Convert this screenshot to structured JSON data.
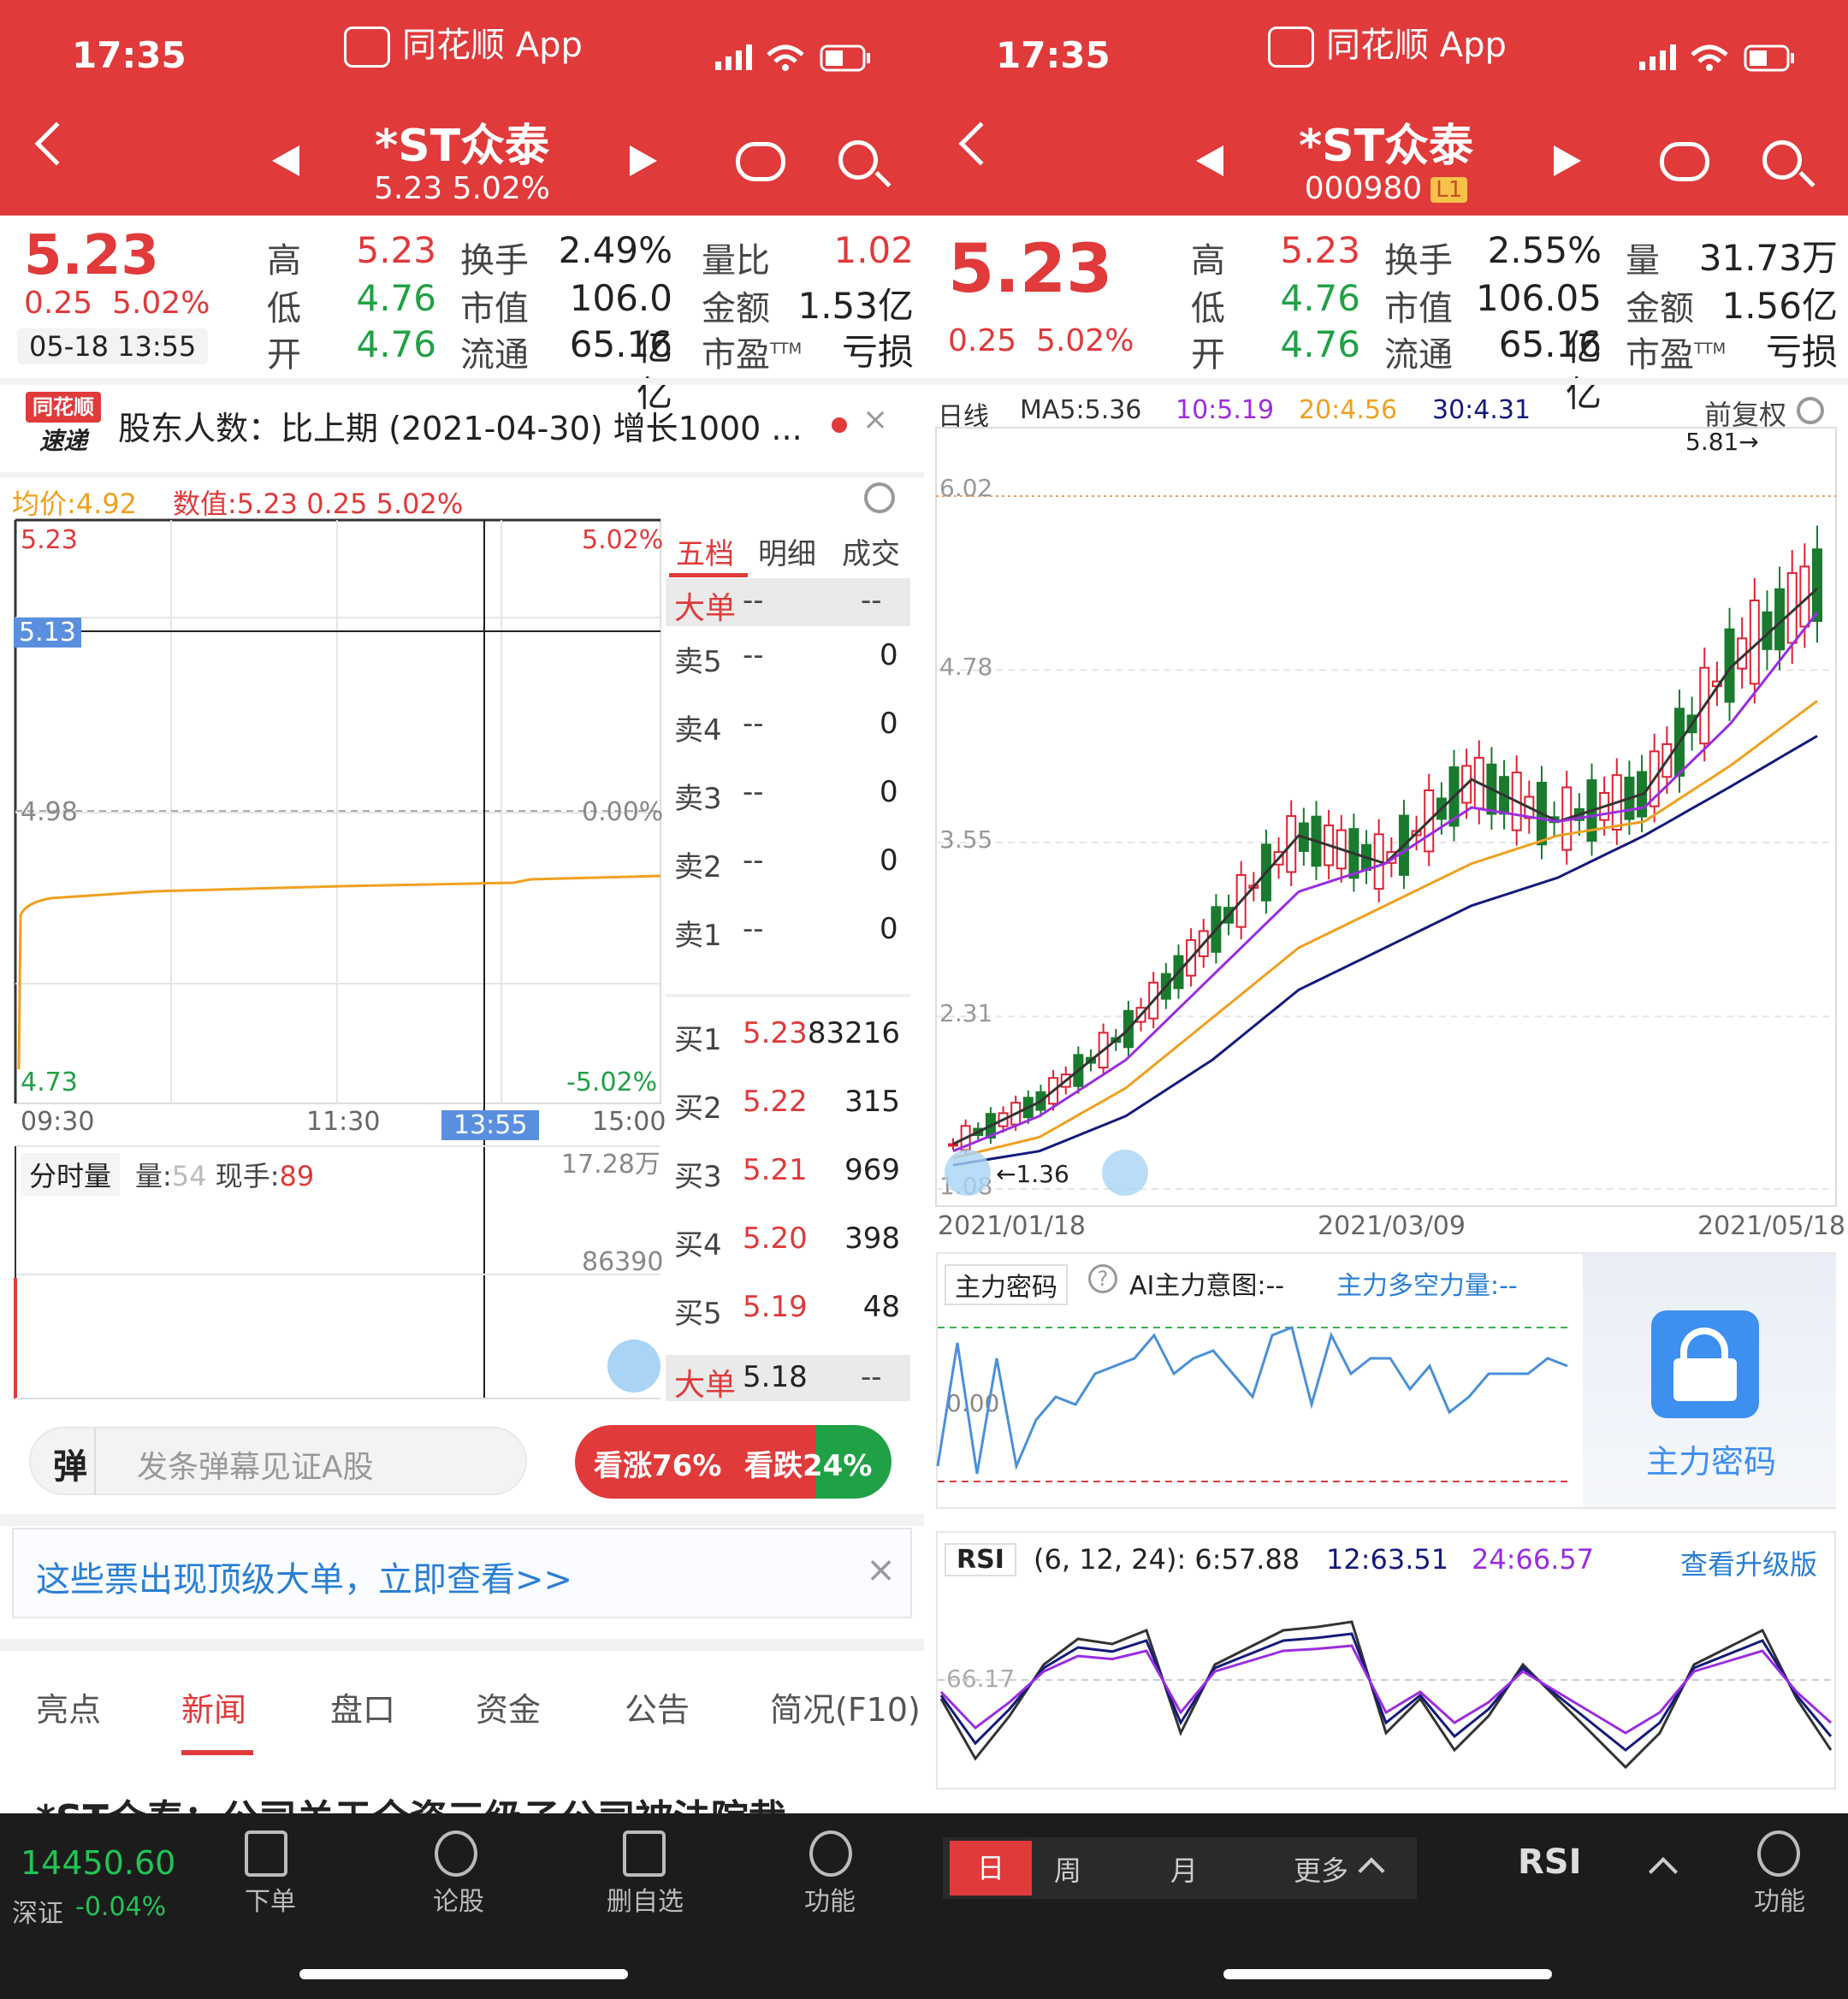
{
  "status_bar": {
    "time": "17:35",
    "app_name": "同花顺 App"
  },
  "left": {
    "header": {
      "title": "*ST众泰",
      "subtitle": "5.23 5.02%"
    },
    "quote": {
      "price": "5.23",
      "change": "0.25",
      "change_pct": "5.02%",
      "timestamp": "05-18 13:55",
      "high_label": "高",
      "high": "5.23",
      "low_label": "低",
      "low": "4.76",
      "open_label": "开",
      "open": "4.76",
      "turnover_label": "换手",
      "turnover": "2.49%",
      "mcap_label": "市值",
      "mcap": "106.0亿",
      "float_label": "流通",
      "float": "65.16亿",
      "vr_label": "量比",
      "vr": "1.02",
      "amount_label": "金额",
      "amount": "1.53亿",
      "pe_label": "市盈",
      "pe_sup": "TTM",
      "pe": "亏损"
    },
    "news_banner": {
      "logo_top": "同花顺",
      "logo_bottom": "速递",
      "text": "股东人数：比上期 (2021-04-30) 增长1000 ..."
    },
    "intraday": {
      "avg_label": "均价:4.92",
      "value_label": "数值:5.23 0.25 5.02%",
      "y_top": "5.23",
      "y_mid": "4.98",
      "y_bot": "4.73",
      "y_cursor": "5.13",
      "pct_top": "5.02%",
      "pct_mid": "0.00%",
      "pct_bot": "-5.02%",
      "x_labels": [
        "09:30",
        "11:30",
        "13:55",
        "15:00"
      ],
      "vol_title": "分时量",
      "vol_label": "量:",
      "vol_value": "54",
      "hand_label": "现手:",
      "hand_value": "89",
      "vol_top": "17.28万",
      "vol_mid": "86390"
    },
    "order_book": {
      "tabs": [
        "五档",
        "明细",
        "成交"
      ],
      "big_top": {
        "label": "大单",
        "price": "--",
        "qty": "--"
      },
      "sells": [
        {
          "label": "卖5",
          "price": "--",
          "qty": "0"
        },
        {
          "label": "卖4",
          "price": "--",
          "qty": "0"
        },
        {
          "label": "卖3",
          "price": "--",
          "qty": "0"
        },
        {
          "label": "卖2",
          "price": "--",
          "qty": "0"
        },
        {
          "label": "卖1",
          "price": "--",
          "qty": "0"
        }
      ],
      "buys": [
        {
          "label": "买1",
          "price": "5.23",
          "qty": "83216"
        },
        {
          "label": "买2",
          "price": "5.22",
          "qty": "315"
        },
        {
          "label": "买3",
          "price": "5.21",
          "qty": "969"
        },
        {
          "label": "买4",
          "price": "5.20",
          "qty": "398"
        },
        {
          "label": "买5",
          "price": "5.19",
          "qty": "48"
        }
      ],
      "big_bottom": {
        "label": "大单",
        "price": "5.18",
        "qty": "--"
      }
    },
    "danmu": {
      "icon": "弹",
      "placeholder": "发条弹幕见证A股"
    },
    "sentiment": {
      "up": "看涨76%",
      "down": "看跌24%",
      "up_pct": 76
    },
    "promo": {
      "text": "这些票出现顶级大单，立即查看>>"
    },
    "tabs": [
      "亮点",
      "新闻",
      "盘口",
      "资金",
      "公告",
      "简况(F10)"
    ],
    "news_cut": "*ST众泰：公司关于全资三级子公司被法院裁",
    "bottom": {
      "index_value": "14450.60",
      "index_name": "深证",
      "index_change": "-0.04%",
      "items": [
        "下单",
        "论股",
        "删自选",
        "功能"
      ]
    }
  },
  "right": {
    "header": {
      "title": "*ST众泰",
      "code": "000980",
      "badge": "L1"
    },
    "quote": {
      "price": "5.23",
      "change": "0.25",
      "change_pct": "5.02%",
      "high_label": "高",
      "high": "5.23",
      "low_label": "低",
      "low": "4.76",
      "open_label": "开",
      "open": "4.76",
      "turnover_label": "换手",
      "turnover": "2.55%",
      "mcap_label": "市值",
      "mcap": "106.05亿",
      "float_label": "流通",
      "float": "65.16亿",
      "vol_label": "量",
      "vol": "31.73万",
      "amount_label": "金额",
      "amount": "1.56亿",
      "pe_label": "市盈",
      "pe_sup": "TTM",
      "pe": "亏损"
    },
    "kline": {
      "type_label": "日线",
      "ma5": "MA5:5.36",
      "ma10": "10:5.19",
      "ma20": "20:4.56",
      "ma30": "30:4.31",
      "adjust": "前复权",
      "y_labels": [
        "6.02",
        "4.78",
        "3.55",
        "2.31",
        "1.08"
      ],
      "x_labels": [
        "2021/01/18",
        "2021/03/09",
        "2021/05/18"
      ],
      "high_mark": "5.81",
      "low_mark": "1.36"
    },
    "main_force": {
      "tag": "主力密码",
      "intent": "AI主力意图:--",
      "power": "主力多空力量:--",
      "zero": "0.00",
      "lock_label": "主力密码"
    },
    "rsi": {
      "tag": "RSI",
      "params": "(6, 12, 24): 6:57.88",
      "v12": "12:63.51",
      "v24": "24:66.57",
      "upgrade": "查看升级版",
      "mid": "66.17"
    },
    "bottom": {
      "periods": [
        "日",
        "周",
        "月"
      ],
      "more": "更多",
      "indicator": "RSI",
      "func": "功能"
    }
  },
  "colors": {
    "brand_red": "#e03a3b",
    "green": "#21a146",
    "ma10": "#9b2de0",
    "ma20": "#f0a020",
    "ma30": "#141a7a",
    "blue_link": "#2a7fd4"
  },
  "chart_data": [
    {
      "type": "line",
      "title": "",
      "series": [
        {
          "name": "均价",
          "values": [
            4.76,
            4.88,
            4.9,
            4.91,
            4.91,
            4.92,
            4.92,
            4.92,
            4.93,
            4.93
          ]
        }
      ],
      "ylim": [
        4.73,
        5.23
      ]
    },
    {
      "type": "line",
      "title": "",
      "x": [
        "2021/01/18",
        "2021/03/09",
        "2021/05/18"
      ],
      "ylim": [
        1.08,
        6.02
      ],
      "series": [
        {
          "name": "MA5",
          "values": [
            1.4,
            1.7,
            2.2,
            2.9,
            3.6,
            3.4,
            4.0,
            3.7,
            3.9,
            4.8,
            5.36
          ]
        },
        {
          "name": "10",
          "values": [
            1.35,
            1.6,
            2.0,
            2.6,
            3.2,
            3.4,
            3.8,
            3.7,
            3.8,
            4.4,
            5.19
          ]
        },
        {
          "name": "20",
          "values": [
            1.3,
            1.45,
            1.8,
            2.3,
            2.8,
            3.1,
            3.4,
            3.6,
            3.7,
            4.1,
            4.56
          ]
        },
        {
          "name": "30",
          "values": [
            1.25,
            1.35,
            1.6,
            2.0,
            2.5,
            2.8,
            3.1,
            3.3,
            3.6,
            3.95,
            4.31
          ]
        }
      ]
    }
  ]
}
